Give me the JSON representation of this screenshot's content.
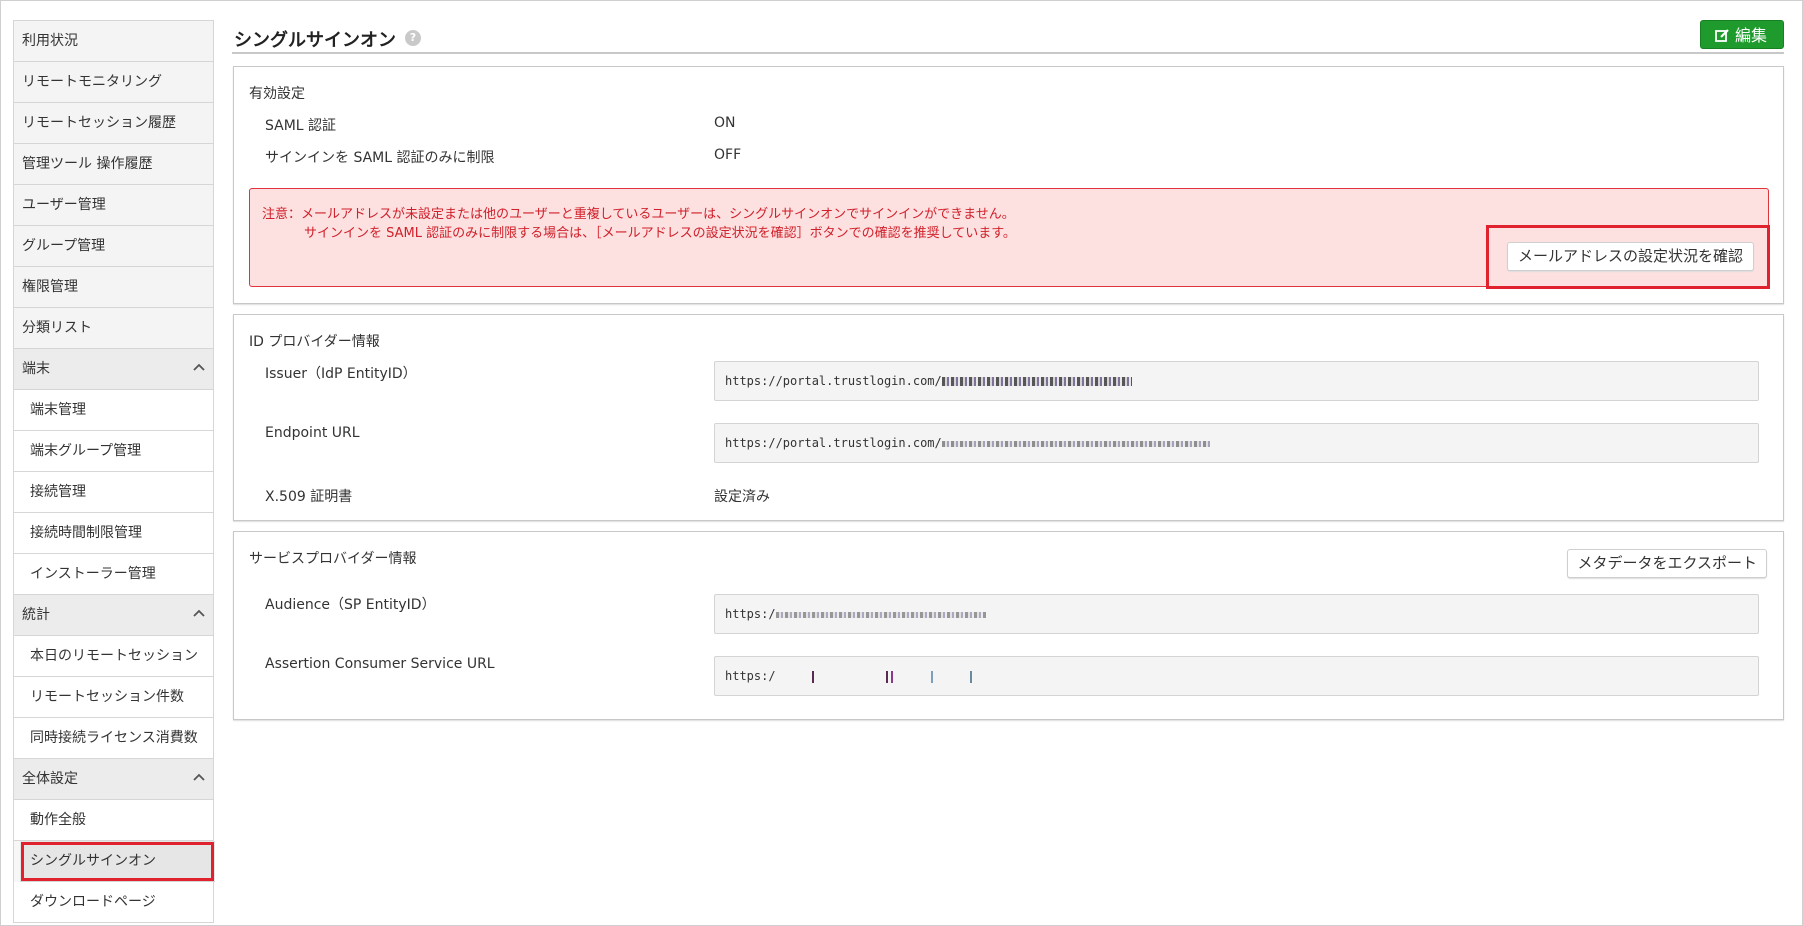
{
  "sidebar": {
    "items": [
      {
        "label": "利用状況"
      },
      {
        "label": "リモートモニタリング"
      },
      {
        "label": "リモートセッション履歴"
      },
      {
        "label": "管理ツール 操作履歴"
      },
      {
        "label": "ユーザー管理"
      },
      {
        "label": "グループ管理"
      },
      {
        "label": "権限管理"
      },
      {
        "label": "分類リスト"
      }
    ],
    "groups": [
      {
        "label": "端末",
        "items": [
          "端末管理",
          "端末グループ管理",
          "接続管理",
          "接続時間制限管理",
          "インストーラー管理"
        ]
      },
      {
        "label": "統計",
        "items": [
          "本日のリモートセッション",
          "リモートセッション件数",
          "同時接続ライセンス消費数"
        ]
      },
      {
        "label": "全体設定",
        "items": [
          "動作全般",
          "シングルサインオン",
          "ダウンロードページ"
        ],
        "active": "シングルサインオン"
      }
    ]
  },
  "header": {
    "title": "シングルサインオン",
    "help": "?",
    "edit_label": "編集"
  },
  "enable_settings": {
    "title": "有効設定",
    "rows": [
      {
        "label": "SAML 認証",
        "value": "ON"
      },
      {
        "label": "サインインを SAML 認証のみに制限",
        "value": "OFF"
      }
    ],
    "warning": {
      "line1": "注意：メールアドレスが未設定または他のユーザーと重複しているユーザーは、シングルサインオンでサインインができません。",
      "line2": "サインインを SAML 認証のみに制限する場合は、［メールアドレスの設定状況を確認］ボタンでの確認を推奨しています。"
    },
    "check_button": "メールアドレスの設定状況を確認"
  },
  "idp": {
    "title": "ID プロバイダー情報",
    "issuer_label": "Issuer（IdP EntityID）",
    "issuer_value": "https://portal.trustlogin.com/",
    "endpoint_label": "Endpoint URL",
    "endpoint_value": "https://portal.trustlogin.com/",
    "cert_label": "X.509 証明書",
    "cert_value": "設定済み"
  },
  "sp": {
    "title": "サービスプロバイダー情報",
    "export_button": "メタデータをエクスポート",
    "audience_label": "Audience（SP EntityID）",
    "audience_value": "https:/",
    "acs_label": "Assertion Consumer Service URL",
    "acs_value": "https:/"
  },
  "colors": {
    "accent_green": "#1f9b2e",
    "warning_red": "#d0202a",
    "highlight_red": "#e0222e"
  }
}
